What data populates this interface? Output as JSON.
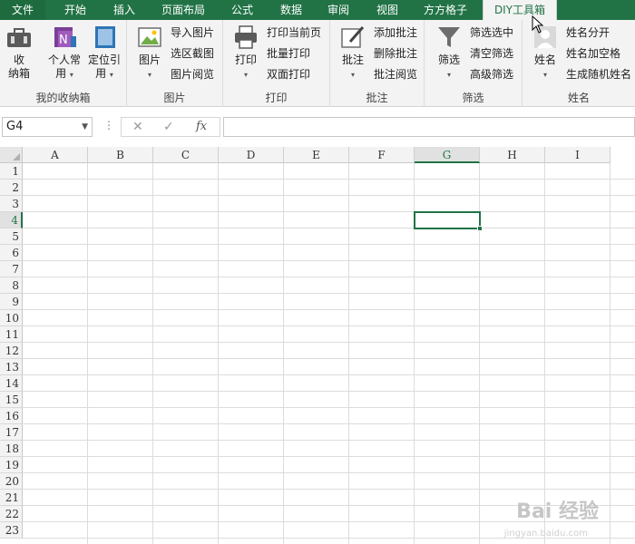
{
  "tabs": [
    "文件",
    "开始",
    "插入",
    "页面布局",
    "公式",
    "数据",
    "审阅",
    "视图",
    "方方格子",
    "DIY工具箱"
  ],
  "active_tab": "DIY工具箱",
  "groups": {
    "favorites": {
      "label": "我的收纳箱",
      "btn1": [
        "收",
        "纳箱"
      ],
      "btn2": [
        "个人常",
        "用"
      ],
      "btn3": [
        "定位引",
        "用"
      ]
    },
    "picture": {
      "label": "图片",
      "big": "图片",
      "small": [
        "导入图片",
        "选区截图",
        "图片阅览"
      ]
    },
    "print": {
      "label": "打印",
      "big": "打印",
      "small": [
        "打印当前页",
        "批量打印",
        "双面打印"
      ]
    },
    "comment": {
      "label": "批注",
      "big": "批注",
      "small": [
        "添加批注",
        "删除批注",
        "批注阅览"
      ]
    },
    "filter": {
      "label": "筛选",
      "big": "筛选",
      "small": [
        "筛选选中",
        "清空筛选",
        "高级筛选"
      ]
    },
    "name": {
      "label": "姓名",
      "big": "姓名",
      "small": [
        "姓名分开",
        "姓名加空格",
        "生成随机姓名"
      ]
    }
  },
  "formula_bar": {
    "name_box": "G4",
    "fx": "fx",
    "value": ""
  },
  "columns": [
    "A",
    "B",
    "C",
    "D",
    "E",
    "F",
    "G",
    "H",
    "I"
  ],
  "rows": [
    "1",
    "2",
    "3",
    "4",
    "5",
    "6",
    "7",
    "8",
    "9",
    "10",
    "11",
    "12",
    "13",
    "14",
    "15",
    "16",
    "17",
    "18",
    "19",
    "20",
    "21",
    "22",
    "23"
  ],
  "selected_col": "G",
  "selected_row": "4",
  "watermark": {
    "main": "Bai 经验",
    "sub": "jingyan.baidu.com"
  },
  "colors": {
    "accent": "#217346",
    "ribbon_bg": "#f3f3f3"
  }
}
